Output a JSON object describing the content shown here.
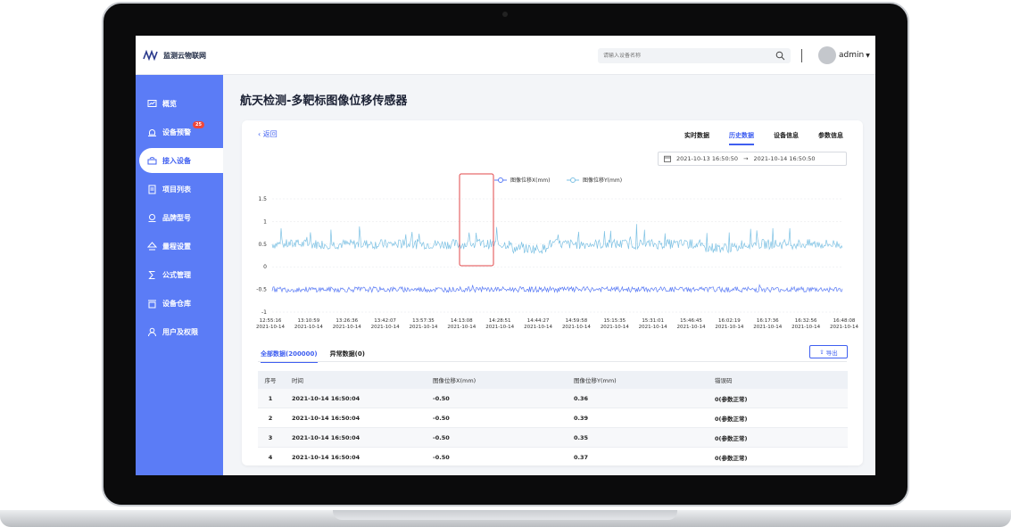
{
  "brand": {
    "name": "监测云物联网"
  },
  "header": {
    "search_placeholder": "请输入设备名称",
    "user": "admin"
  },
  "sidebar": {
    "items": [
      {
        "label": "概览",
        "icon": "chart-icon"
      },
      {
        "label": "设备预警",
        "icon": "alarm-icon",
        "badge": "25"
      },
      {
        "label": "接入设备",
        "icon": "device-icon",
        "active": true
      },
      {
        "label": "项目列表",
        "icon": "list-icon"
      },
      {
        "label": "品牌型号",
        "icon": "brand-icon"
      },
      {
        "label": "量程设置",
        "icon": "range-icon"
      },
      {
        "label": "公式管理",
        "icon": "formula-icon"
      },
      {
        "label": "设备仓库",
        "icon": "warehouse-icon"
      },
      {
        "label": "用户及权限",
        "icon": "user-icon"
      }
    ]
  },
  "main": {
    "title": "航天检测-多靶标图像位移传感器",
    "back": "返回",
    "tabs": [
      "实时数据",
      "历史数据",
      "设备信息",
      "参数信息"
    ],
    "range": {
      "start": "2021-10-13 16:50:50",
      "arrow": "→",
      "end": "2021-10-14 16:50:50"
    },
    "subtabs": [
      "全部数据(200000)",
      "异常数据(0)"
    ],
    "export": "导出",
    "table": {
      "headers": [
        "序号",
        "时间",
        "图像位移X(mm)",
        "图像位移Y(mm)",
        "错误码"
      ],
      "rows": [
        [
          "1",
          "2021-10-14 16:50:04",
          "-0.50",
          "0.36",
          "0(参数正常)"
        ],
        [
          "2",
          "2021-10-14 16:50:04",
          "-0.50",
          "0.39",
          "0(参数正常)"
        ],
        [
          "3",
          "2021-10-14 16:50:04",
          "-0.50",
          "0.35",
          "0(参数正常)"
        ],
        [
          "4",
          "2021-10-14 16:50:04",
          "-0.50",
          "0.37",
          "0(参数正常)"
        ]
      ]
    }
  },
  "chart_data": {
    "type": "line",
    "legend": [
      "图像位移X(mm)",
      "图像位移Y(mm)"
    ],
    "colors": {
      "x": "#5b7cf6",
      "y": "#7ec2e4"
    },
    "yticks": [
      "1.5",
      "1",
      "0.5",
      "0",
      "-0.5",
      "-1"
    ],
    "ylim": [
      -1,
      1.5
    ],
    "xticks": [
      [
        "12:55:16",
        "2021-10-14"
      ],
      [
        "13:10:59",
        "2021-10-14"
      ],
      [
        "13:26:36",
        "2021-10-14"
      ],
      [
        "13:42:07",
        "2021-10-14"
      ],
      [
        "13:57:35",
        "2021-10-14"
      ],
      [
        "14:13:08",
        "2021-10-14"
      ],
      [
        "14:28:51",
        "2021-10-14"
      ],
      [
        "14:44:27",
        "2021-10-14"
      ],
      [
        "14:59:58",
        "2021-10-14"
      ],
      [
        "15:15:35",
        "2021-10-14"
      ],
      [
        "15:31:01",
        "2021-10-14"
      ],
      [
        "15:46:45",
        "2021-10-14"
      ],
      [
        "16:02:19",
        "2021-10-14"
      ],
      [
        "16:17:36",
        "2021-10-14"
      ],
      [
        "16:32:56",
        "2021-10-14"
      ],
      [
        "16:48:08",
        "2021-10-14"
      ]
    ],
    "series": [
      {
        "name": "图像位移X(mm)",
        "mean": -0.5
      },
      {
        "name": "图像位移Y(mm)",
        "mean": 0.5
      }
    ]
  }
}
